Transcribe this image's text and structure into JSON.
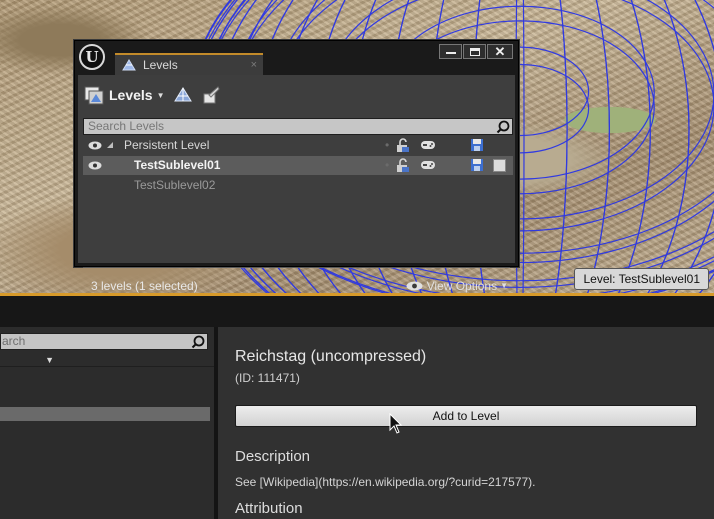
{
  "viewport": {
    "level_badge": "Level:  TestSublevel01"
  },
  "levels_window": {
    "tab_title": "Levels",
    "tab_close": "×",
    "window_buttons": {
      "close": "✕"
    },
    "toolbar": {
      "levels_menu_label": "Levels"
    },
    "search_placeholder": "Search Levels",
    "rows": [
      {
        "name": "Persistent Level",
        "state": "expanded"
      },
      {
        "name": "TestSublevel01",
        "state": "selected"
      },
      {
        "name": "TestSublevel02",
        "state": "unloaded"
      }
    ],
    "row_marker": "•",
    "footer_status": "3 levels (1 selected)",
    "view_options_label": "View Options"
  },
  "left_panel": {
    "search_text": "arch"
  },
  "details": {
    "title": "Reichstag (uncompressed)",
    "id_text": "(ID: 111471)",
    "add_button_label": "Add to Level",
    "description_heading": "Description",
    "description_text": "See [Wikipedia](https://en.wikipedia.org/?curid=217577).",
    "attribution_heading": "Attribution"
  },
  "colors": {
    "accent_orange": "#d79a2a",
    "wireframe_blue": "#2a35e6",
    "panel_bg": "#3e3e3e",
    "selected_row": "#5c5c5c"
  },
  "icons": {
    "window_logo": "unreal-engine-logo",
    "tab": "levels-tab-icon",
    "visibility": "eye-icon",
    "lock": "lock-icon",
    "gamepad": "gamepad-icon",
    "save": "save-icon",
    "search": "search-icon"
  }
}
